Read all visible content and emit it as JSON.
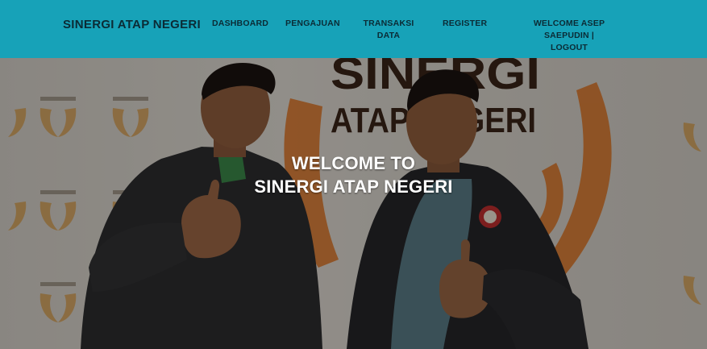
{
  "navbar": {
    "brand": "SINERGI ATAP NEGERI",
    "links": {
      "dashboard": "DASHBOARD",
      "pengajuan": "PENGAJUAN",
      "transaksi_line1": "TRANSAKSI",
      "transaksi_line2": "DATA",
      "register": "REGISTER",
      "user_line1": "WELCOME ASEP SAEPUDIN |",
      "user_line2": "LOGOUT"
    },
    "background_color": "#17a2b8",
    "text_color": "#0b2b35"
  },
  "hero": {
    "title_line1": "WELCOME TO",
    "title_line2": "SINERGI ATAP NEGERI",
    "banner_text_line1": "SINERGI",
    "banner_text_line2": "ATAP NEGERI",
    "overlay_color": "rgba(0,0,0,0.36)"
  }
}
